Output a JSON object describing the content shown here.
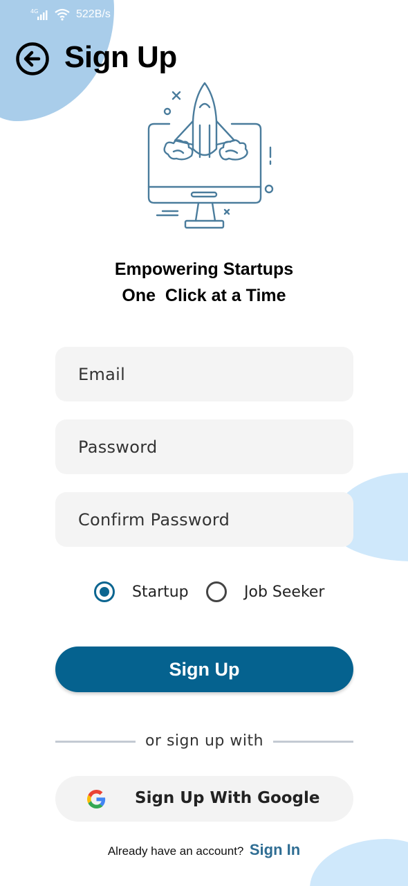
{
  "status_bar": {
    "network": "4G",
    "speed": "522B/s"
  },
  "header": {
    "title": "Sign Up"
  },
  "tagline": {
    "line1": "Empowering Startups",
    "line2": "One  Click at a Time"
  },
  "form": {
    "email_placeholder": "Email",
    "password_placeholder": "Password",
    "confirm_placeholder": "Confirm Password",
    "role_options": [
      {
        "label": "Startup",
        "checked": true
      },
      {
        "label": "Job Seeker",
        "checked": false
      }
    ],
    "submit_label": "Sign Up"
  },
  "alt": {
    "divider_text": "or sign up with",
    "google_label": "Sign Up With Google"
  },
  "footer": {
    "question": "Already have an account?",
    "link": "Sign In"
  },
  "colors": {
    "primary": "#05628f",
    "link": "#2f6d93",
    "blob_dark": "#a9cdea",
    "blob_light": "#cfe8fb",
    "field_bg": "#f4f4f4",
    "illustration": "#4a7c9c"
  },
  "icons": [
    "signal-icon",
    "wifi-icon",
    "back-arrow-icon",
    "rocket-monitor-illustration",
    "google-icon"
  ]
}
